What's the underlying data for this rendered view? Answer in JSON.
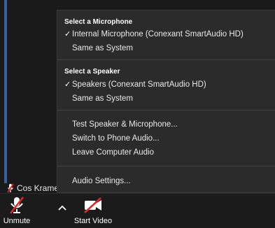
{
  "menu": {
    "mic_section_title": "Select a Microphone",
    "mic_items": [
      {
        "label": "Internal Microphone (Conexant SmartAudio HD)",
        "checked": true
      },
      {
        "label": "Same as System",
        "checked": false
      }
    ],
    "speaker_section_title": "Select a Speaker",
    "speaker_items": [
      {
        "label": "Speakers (Conexant SmartAudio HD)",
        "checked": true
      },
      {
        "label": "Same as System",
        "checked": false
      }
    ],
    "actions": [
      "Test Speaker & Microphone...",
      "Switch to Phone Audio...",
      "Leave Computer Audio"
    ],
    "audio_settings": "Audio Settings...",
    "checkmark": "✓"
  },
  "participant": {
    "name": "Cos Kramer"
  },
  "toolbar": {
    "unmute_label": "Unmute",
    "start_video_label": "Start Video"
  },
  "colors": {
    "menu_bg": "#2b2b2b",
    "muted_red": "#e02828",
    "toolbar_bg": "#1b1b1b"
  }
}
